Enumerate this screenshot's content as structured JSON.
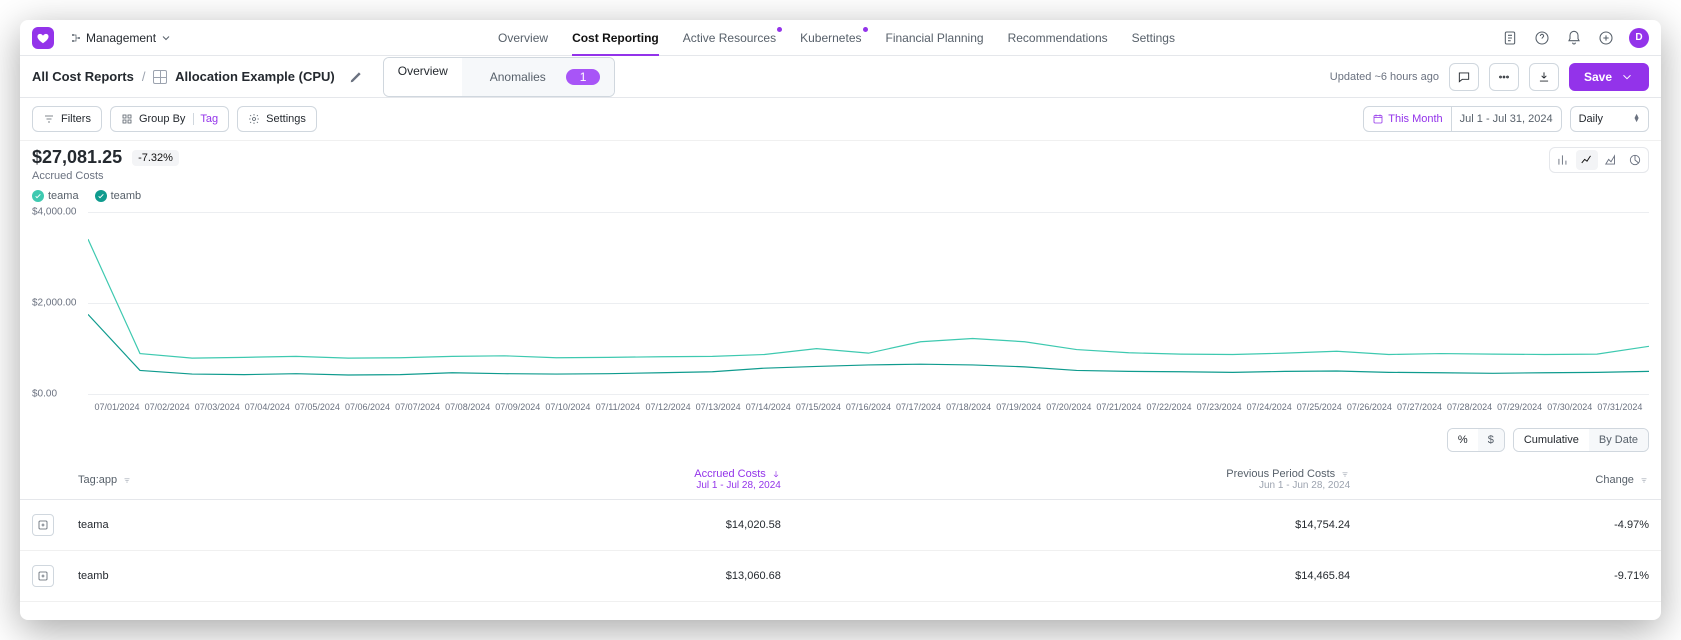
{
  "workspace": "Management",
  "nav": {
    "overview": "Overview",
    "cost_reporting": "Cost Reporting",
    "active_resources": "Active Resources",
    "kubernetes": "Kubernetes",
    "financial_planning": "Financial Planning",
    "recommendations": "Recommendations",
    "settings": "Settings"
  },
  "avatar_initial": "D",
  "breadcrumb": {
    "root": "All Cost Reports",
    "current": "Allocation Example (CPU)"
  },
  "subtabs": {
    "overview": "Overview",
    "anomalies": "Anomalies",
    "anomaly_count": "1"
  },
  "updated": "Updated ~6 hours ago",
  "save": "Save",
  "toolbar": {
    "filters": "Filters",
    "group_by": "Group By",
    "group_by_tag": "Tag",
    "settings": "Settings",
    "quick_range": "This Month",
    "range_text": "Jul 1 - Jul 31, 2024",
    "granularity": "Daily"
  },
  "metric": {
    "value": "$27,081.25",
    "delta": "-7.32%",
    "label": "Accrued Costs"
  },
  "legend": {
    "a": "teama",
    "b": "teamb"
  },
  "colors": {
    "teama": "#3ec9b0",
    "teamb": "#0f9b8e"
  },
  "table": {
    "ctrl_pct": "%",
    "ctrl_usd": "$",
    "ctrl_cum": "Cumulative",
    "ctrl_bydate": "By Date",
    "h_tag": "Tag:app",
    "h_accrued": "Accrued Costs",
    "h_accrued_sub": "Jul 1 - Jul 28, 2024",
    "h_prev": "Previous Period Costs",
    "h_prev_sub": "Jun 1 - Jun 28, 2024",
    "h_change": "Change",
    "rows": [
      {
        "tag": "teama",
        "accrued": "$14,020.58",
        "prev": "$14,754.24",
        "change": "-4.97%"
      },
      {
        "tag": "teamb",
        "accrued": "$13,060.68",
        "prev": "$14,465.84",
        "change": "-9.71%"
      }
    ]
  },
  "chart_data": {
    "type": "line",
    "xlabel": "",
    "ylabel": "",
    "ylim": [
      0,
      4000
    ],
    "yticks": [
      "$4,000.00",
      "$2,000.00",
      "$0.00"
    ],
    "x": [
      "07/01/2024",
      "07/02/2024",
      "07/03/2024",
      "07/04/2024",
      "07/05/2024",
      "07/06/2024",
      "07/07/2024",
      "07/08/2024",
      "07/09/2024",
      "07/10/2024",
      "07/11/2024",
      "07/12/2024",
      "07/13/2024",
      "07/14/2024",
      "07/15/2024",
      "07/16/2024",
      "07/17/2024",
      "07/18/2024",
      "07/19/2024",
      "07/20/2024",
      "07/21/2024",
      "07/22/2024",
      "07/23/2024",
      "07/24/2024",
      "07/25/2024",
      "07/26/2024",
      "07/27/2024",
      "07/28/2024",
      "07/29/2024",
      "07/30/2024",
      "07/31/2024"
    ],
    "series": [
      {
        "name": "teama",
        "color": "#3ec9b0",
        "values": [
          3400,
          890,
          790,
          810,
          830,
          790,
          800,
          830,
          840,
          800,
          810,
          820,
          830,
          870,
          1000,
          900,
          1150,
          1220,
          1150,
          980,
          910,
          880,
          870,
          900,
          940,
          870,
          890,
          880,
          870,
          880,
          1050
        ]
      },
      {
        "name": "teamb",
        "color": "#0f9b8e",
        "values": [
          1750,
          520,
          440,
          430,
          450,
          420,
          430,
          470,
          450,
          440,
          450,
          470,
          490,
          570,
          610,
          640,
          660,
          640,
          600,
          520,
          500,
          490,
          480,
          500,
          510,
          480,
          470,
          460,
          470,
          480,
          500
        ]
      }
    ]
  }
}
